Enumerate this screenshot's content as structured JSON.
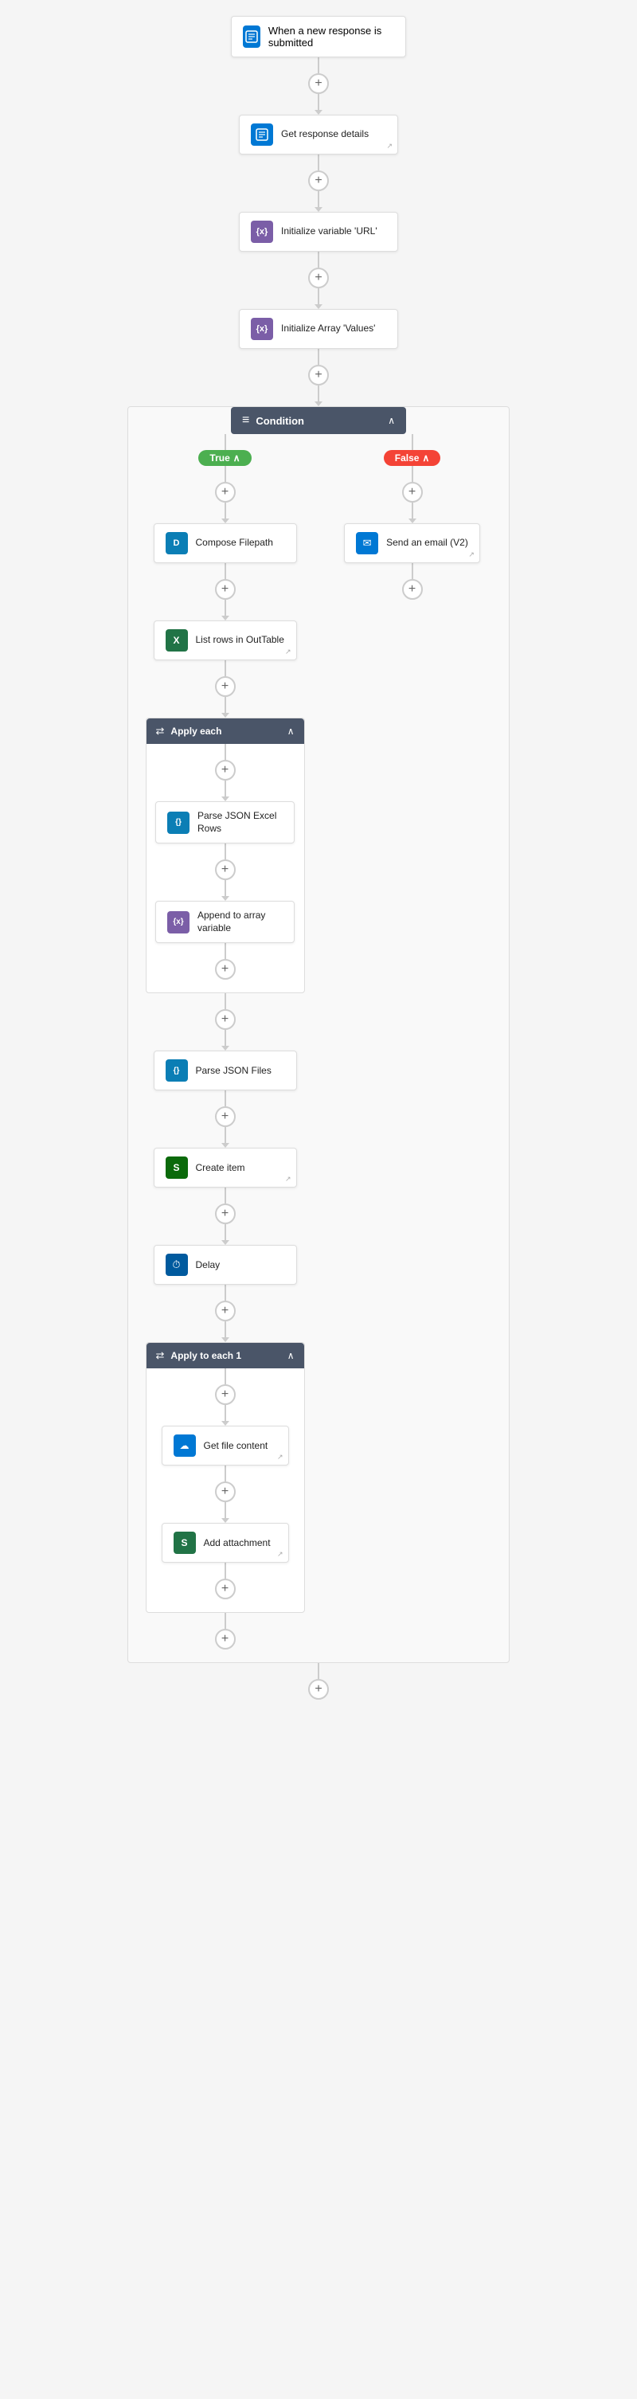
{
  "flow": {
    "trigger": {
      "label": "When a new response is submitted",
      "icon": "form-icon",
      "icon_color": "#0078d4",
      "icon_char": "📋"
    },
    "steps": [
      {
        "id": "get-response",
        "label": "Get response details",
        "icon_color": "#0078d4",
        "icon_char": "📋",
        "has_corner": true
      },
      {
        "id": "init-url",
        "label": "Initialize variable 'URL'",
        "icon_color": "#7B5EA7",
        "icon_char": "{x}"
      },
      {
        "id": "init-array",
        "label": "Initialize Array 'Values'",
        "icon_color": "#7B5EA7",
        "icon_char": "{x}"
      }
    ],
    "condition": {
      "label": "Condition",
      "icon_char": "≡",
      "true_branch": {
        "label": "True",
        "steps": [
          {
            "id": "compose-filepath",
            "label": "Compose Filepath",
            "icon_color": "#0b7eb5",
            "icon_char": "D"
          },
          {
            "id": "list-rows",
            "label": "List rows in OutTable",
            "icon_color": "#217346",
            "icon_char": "X",
            "has_corner": true
          }
        ],
        "loop1": {
          "label": "Apply each",
          "steps": [
            {
              "id": "parse-json-excel",
              "label": "Parse JSON Excel Rows",
              "icon_color": "#0b7eb5",
              "icon_char": "{}"
            },
            {
              "id": "append-array",
              "label": "Append to array variable",
              "icon_color": "#7B5EA7",
              "icon_char": "{x}"
            }
          ]
        },
        "after_loop1": [
          {
            "id": "parse-json-files",
            "label": "Parse JSON Files",
            "icon_color": "#0b7eb5",
            "icon_char": "{}"
          },
          {
            "id": "create-item",
            "label": "Create item",
            "icon_color": "#0b6a0b",
            "icon_char": "S",
            "has_corner": true
          },
          {
            "id": "delay",
            "label": "Delay",
            "icon_color": "#005a9e",
            "icon_char": "⏱"
          }
        ],
        "loop2": {
          "label": "Apply to each 1",
          "steps": [
            {
              "id": "get-file-content",
              "label": "Get file content",
              "icon_color": "#0078d4",
              "icon_char": "☁",
              "has_corner": true
            },
            {
              "id": "add-attachment",
              "label": "Add attachment",
              "icon_color": "#217346",
              "icon_char": "S",
              "has_corner": true
            }
          ]
        }
      },
      "false_branch": {
        "label": "False",
        "steps": [
          {
            "id": "send-email",
            "label": "Send an email (V2)",
            "icon_color": "#0078d4",
            "icon_char": "✉",
            "has_corner": true
          }
        ]
      }
    }
  },
  "ui": {
    "plus_label": "+",
    "chevron_up": "∧",
    "chevron_down": "∨",
    "corner_icon": "↗"
  }
}
